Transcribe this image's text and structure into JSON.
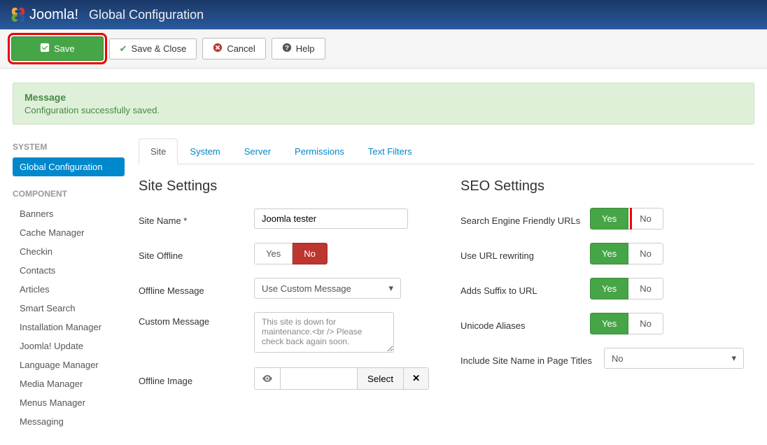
{
  "header": {
    "brand": "Joomla!",
    "page_title": "Global Configuration"
  },
  "toolbar": {
    "save": "Save",
    "save_close": "Save & Close",
    "cancel": "Cancel",
    "help": "Help"
  },
  "alert": {
    "title": "Message",
    "text": "Configuration successfully saved."
  },
  "sidebar": {
    "groups": [
      {
        "title": "SYSTEM",
        "items": [
          {
            "label": "Global Configuration",
            "active": true
          }
        ]
      },
      {
        "title": "COMPONENT",
        "items": [
          {
            "label": "Banners"
          },
          {
            "label": "Cache Manager"
          },
          {
            "label": "Checkin"
          },
          {
            "label": "Contacts"
          },
          {
            "label": "Articles"
          },
          {
            "label": "Smart Search"
          },
          {
            "label": "Installation Manager"
          },
          {
            "label": "Joomla! Update"
          },
          {
            "label": "Language Manager"
          },
          {
            "label": "Media Manager"
          },
          {
            "label": "Menus Manager"
          },
          {
            "label": "Messaging"
          }
        ]
      }
    ]
  },
  "tabs": [
    "Site",
    "System",
    "Server",
    "Permissions",
    "Text Filters"
  ],
  "site_settings": {
    "title": "Site Settings",
    "site_name_label": "Site Name *",
    "site_name_value": "Joomla tester",
    "site_offline_label": "Site Offline",
    "offline_message_label": "Offline Message",
    "offline_message_value": "Use Custom Message",
    "custom_message_label": "Custom Message",
    "custom_message_value": "This site is down for maintenance.<br /> Please check back again soon.",
    "offline_image_label": "Offline Image",
    "select_btn": "Select",
    "yes": "Yes",
    "no": "No"
  },
  "seo_settings": {
    "title": "SEO Settings",
    "sef_label": "Search Engine Friendly URLs",
    "rewrite_label": "Use URL rewriting",
    "suffix_label": "Adds Suffix to URL",
    "unicode_label": "Unicode Aliases",
    "sitename_titles_label": "Include Site Name in Page Titles",
    "sitename_titles_value": "No",
    "yes": "Yes",
    "no": "No"
  }
}
